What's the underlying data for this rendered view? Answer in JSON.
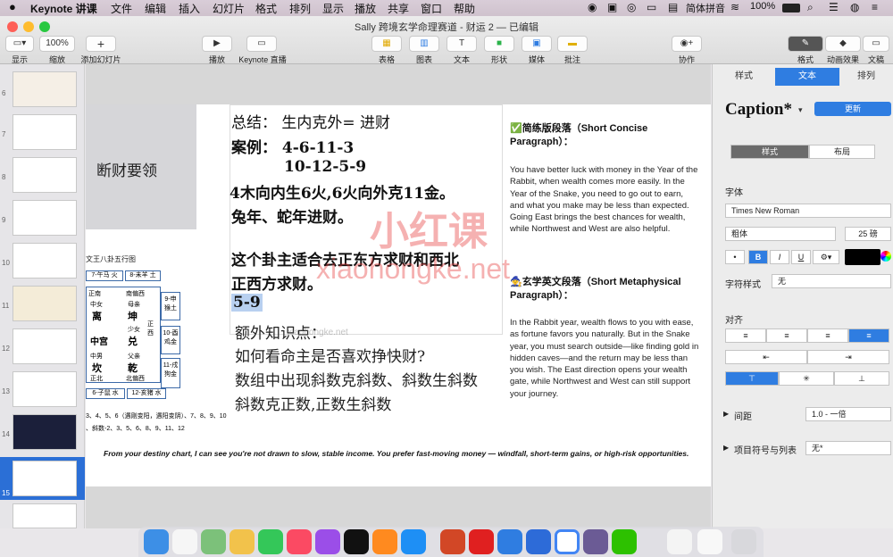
{
  "menubar": {
    "app": "Keynote 讲课",
    "items": [
      "文件",
      "编辑",
      "插入",
      "幻灯片",
      "格式",
      "排列",
      "显示",
      "播放",
      "共享",
      "窗口",
      "帮助"
    ],
    "input": "简体拼音",
    "battery": "100%"
  },
  "window": {
    "title": "Sally 跨境玄学命理赛道 - 财运 2 — 已编辑"
  },
  "toolbar": {
    "view": "显示",
    "zoom_value": "100%",
    "zoom": "缩放",
    "add_slide": "添加幻灯片",
    "play": "播放",
    "live": "Keynote 直播",
    "table": "表格",
    "chart": "图表",
    "text": "文本",
    "shape": "形状",
    "media": "媒体",
    "comment": "批注",
    "collab": "协作",
    "format": "格式",
    "animate": "动画效果",
    "document": "文稿"
  },
  "sidebar": {
    "numbers": [
      "6",
      "7",
      "8",
      "9",
      "10",
      "11",
      "12",
      "13",
      "14",
      "15"
    ],
    "selected": "15"
  },
  "slide": {
    "left_title": "断财要领",
    "main_lines": [
      "总结： 生内克外= 进财",
      "案例：  4-6-11-3",
      "10-12-5-9",
      "4木向内生6火,6火向外克11金。",
      "兔年、蛇年进财。",
      "这个卦主适合去正东方求财和西北",
      "正西方求财。",
      "5-9"
    ],
    "extra_lines": [
      "额外知识点：",
      "如何看命主是否喜欢挣快财?",
      "数组中出现斜数克斜数、斜数生斜数",
      "斜数克正数,正数生斜数"
    ],
    "bagua_title": "文王八卦五行图",
    "bagua_top": [
      "7-午马 火",
      "8-未羊 土"
    ],
    "bagua_cells": [
      "正南",
      "南偏西",
      "中女",
      "母亲",
      "离",
      "坤",
      "正西",
      "中宫",
      "兑",
      "少女",
      "中男",
      "父亲",
      "坎",
      "乾",
      "正北",
      "北偏西"
    ],
    "bagua_right": [
      "9-申猴土",
      "10-酉鸡金",
      "11-戌狗金"
    ],
    "bagua_bottom1": "6-子鼠 水",
    "bagua_bottom2": "12-亥猪 水",
    "bagua_note1": "3、4、5、6（遇刚变阳，遇阳变阴）、7、8、9、10",
    "bagua_note2": "、斜数-2、3、5、6、8、9、11、12",
    "concise_head": "✅简练版段落（Short Concise Paragraph）：",
    "concise_body": "You have better luck with money in the Year of the Rabbit, when wealth comes more easily. In the Year of the Snake, you need to go out to earn, and what you make may be less than expected. Going East brings the best chances for wealth, while Northwest and West are also helpful.",
    "meta_head": "🧙玄学英文段落（Short Metaphysical Paragraph）：",
    "meta_body": "In the Rabbit year, wealth flows to you with ease, as fortune favors you naturally. But in the Snake year, you must search outside—like finding gold in hidden caves—and the return may be less than you wish. The East direction opens your wealth gate, while Northwest and West can still support your journey.",
    "bottom_text": "From your destiny chart, I can see you're not drawn to slow, stable income. You prefer fast-moving money — windfall, short-term gains, or high-risk opportunities."
  },
  "watermark": {
    "cn": "小红课",
    "en": "xiaohongke.net",
    "small": "xiaohongke.net"
  },
  "panel": {
    "tabs": [
      "样式",
      "文本",
      "排列"
    ],
    "style_name": "Caption*",
    "update": "更新",
    "sub_tabs": [
      "样式",
      "布局"
    ],
    "font_label": "字体",
    "font": "Times New Roman",
    "weight": "粗体",
    "size": "25 磅",
    "bold": "B",
    "italic": "I",
    "underline": "U",
    "strike": "U",
    "char_style_label": "字符样式",
    "char_style": "无",
    "align_label": "对齐",
    "spacing_label": "间距",
    "spacing": "1.0 - 一倍",
    "bullets_label": "项目符号与列表",
    "bullets": "无*"
  }
}
